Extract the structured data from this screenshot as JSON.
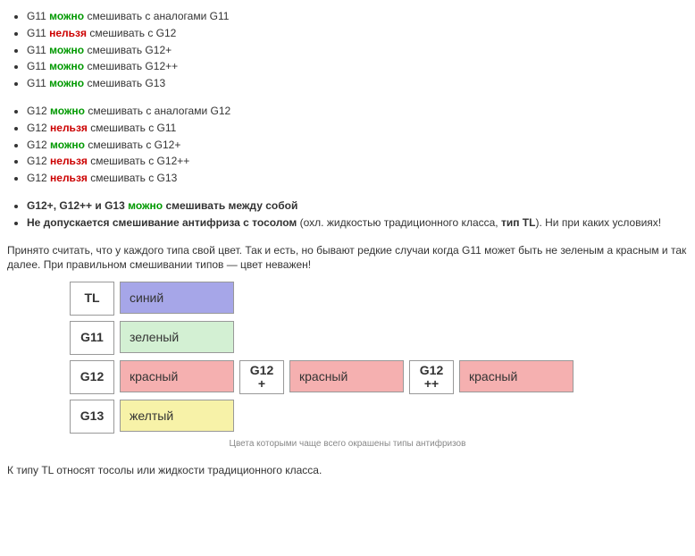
{
  "lists": {
    "g11": [
      {
        "prefix": "G11 ",
        "tag": "можно",
        "tagClass": "mozhno",
        "suffix": " смешивать с аналогами G11"
      },
      {
        "prefix": "G11 ",
        "tag": "нельзя",
        "tagClass": "nelzya",
        "suffix": " смешивать с G12"
      },
      {
        "prefix": "G11 ",
        "tag": "можно",
        "tagClass": "mozhno",
        "suffix": " смешивать G12+"
      },
      {
        "prefix": "G11 ",
        "tag": "можно",
        "tagClass": "mozhno",
        "suffix": " смешивать G12++"
      },
      {
        "prefix": "G11 ",
        "tag": "можно",
        "tagClass": "mozhno",
        "suffix": " смешивать G13"
      }
    ],
    "g12": [
      {
        "prefix": "G12 ",
        "tag": "можно",
        "tagClass": "mozhno",
        "suffix": " смешивать с аналогами G12"
      },
      {
        "prefix": "G12 ",
        "tag": "нельзя",
        "tagClass": "nelzya",
        "suffix": " смешивать с G11"
      },
      {
        "prefix": "G12 ",
        "tag": "можно",
        "tagClass": "mozhno",
        "suffix": " смешивать с G12+"
      },
      {
        "prefix": "G12 ",
        "tag": "нельзя",
        "tagClass": "nelzya",
        "suffix": " смешивать с G12++"
      },
      {
        "prefix": "G12 ",
        "tag": "нельзя",
        "tagClass": "nelzya",
        "suffix": " смешивать с G13"
      }
    ],
    "summary": [
      {
        "prefix": "G12+, G12++ и G13 ",
        "tag": "можно",
        "tagClass": "mozhno",
        "suffix": " смешивать между собой",
        "bold": true
      },
      {
        "boldPart": "Не допускается смешивание антифриза с тосолом",
        "midPart": " (охл. жидкостью традиционного класса, ",
        "boldPart2": "тип TL",
        "endPart": "). Ни при каких условиях!"
      }
    ]
  },
  "paragraph1": "Принято считать, что у каждого типа свой цвет. Так и есть, но бывают редкие случаи когда G11 может быть не зеленым а красным и так далее. При правильном смешивании типов — цвет неважен!",
  "chart": {
    "rows": [
      {
        "cells": [
          {
            "label": "TL"
          },
          {
            "color": "blue",
            "text": "синий"
          }
        ]
      },
      {
        "cells": [
          {
            "label": "G11"
          },
          {
            "color": "green",
            "text": "зеленый"
          }
        ]
      },
      {
        "cells": [
          {
            "label": "G12"
          },
          {
            "color": "red",
            "text": "красный"
          },
          {
            "label": "G12+"
          },
          {
            "color": "red",
            "text": "красный"
          },
          {
            "label": "G12++"
          },
          {
            "color": "red",
            "text": "красный"
          }
        ]
      },
      {
        "cells": [
          {
            "label": "G13"
          },
          {
            "color": "yellow",
            "text": "желтый"
          }
        ]
      }
    ],
    "caption": "Цвета которыми чаще всего окрашены типы антифризов"
  },
  "paragraph2": "К типу TL относят тосолы или жидкости традиционного класса."
}
